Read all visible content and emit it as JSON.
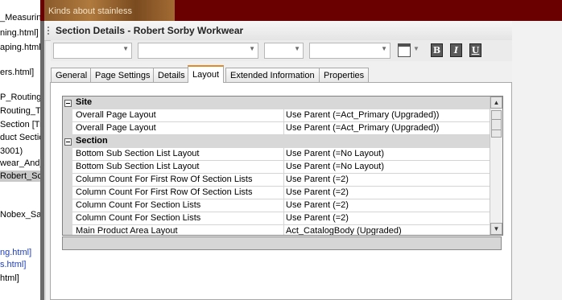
{
  "tree": {
    "items": [
      {
        "label": "_Measurin",
        "color": "black"
      },
      {
        "label": "ning.html]",
        "color": "black"
      },
      {
        "label": "aping.html",
        "color": "black"
      },
      {
        "label": "ers.html]",
        "color": "black"
      },
      {
        "label": "P_Routing.",
        "color": "black"
      },
      {
        "label": "Routing_T",
        "color": "black"
      },
      {
        "label": "Section [Tre",
        "color": "black"
      },
      {
        "label": "duct Sectic",
        "color": "black"
      },
      {
        "label": "3001)",
        "color": "black"
      },
      {
        "label": "wear_And_",
        "color": "black"
      },
      {
        "label": "Robert_Sc",
        "color": "black"
      },
      {
        "label": "Nobex_Sav",
        "color": "black"
      },
      {
        "label": "ng.html]",
        "color": "blue"
      },
      {
        "label": "s.html]",
        "color": "blue"
      },
      {
        "label": "html]",
        "color": "black"
      }
    ]
  },
  "background": {
    "photo_caption": "Kinds about stainless"
  },
  "dialog": {
    "title": "Section Details - Robert Sorby Workwear",
    "toolbar": {
      "combos": [
        "",
        "",
        "",
        ""
      ],
      "buttons": [
        {
          "icon": "table-icon"
        },
        {
          "icon": "bold-icon",
          "glyph": "B"
        },
        {
          "icon": "italic-icon",
          "glyph": "I"
        },
        {
          "icon": "underline-icon",
          "glyph": "U"
        }
      ]
    },
    "tabs": [
      {
        "label": "General",
        "active": false
      },
      {
        "label": "Page Settings",
        "active": false
      },
      {
        "label": "Details",
        "active": false
      },
      {
        "label": "Layout",
        "active": true
      },
      {
        "label": "Extended Information",
        "active": false
      },
      {
        "label": "Properties",
        "active": false
      }
    ],
    "grid": {
      "categories": [
        {
          "label": "Site",
          "rows": [
            {
              "name": "Overall Page Layout",
              "value": "Use Parent (=Act_Primary (Upgraded))"
            },
            {
              "name": "Overall Page Layout",
              "value": "Use Parent (=Act_Primary (Upgraded))"
            }
          ]
        },
        {
          "label": "Section",
          "rows": [
            {
              "name": "Bottom Sub Section List Layout",
              "value": "Use Parent (=No Layout)"
            },
            {
              "name": "Bottom Sub Section List Layout",
              "value": "Use Parent (=No Layout)"
            },
            {
              "name": "Column Count For First Row Of Section Lists",
              "value": "Use Parent (=2)"
            },
            {
              "name": "Column Count For First Row Of Section Lists",
              "value": "Use Parent (=2)"
            },
            {
              "name": "Column Count For Section Lists",
              "value": "Use Parent (=2)"
            },
            {
              "name": "Column Count For Section Lists",
              "value": "Use Parent (=2)"
            },
            {
              "name": "Main Product Area Layout",
              "value": "Act_CatalogBody (Upgraded)"
            }
          ]
        }
      ]
    },
    "description": ""
  }
}
